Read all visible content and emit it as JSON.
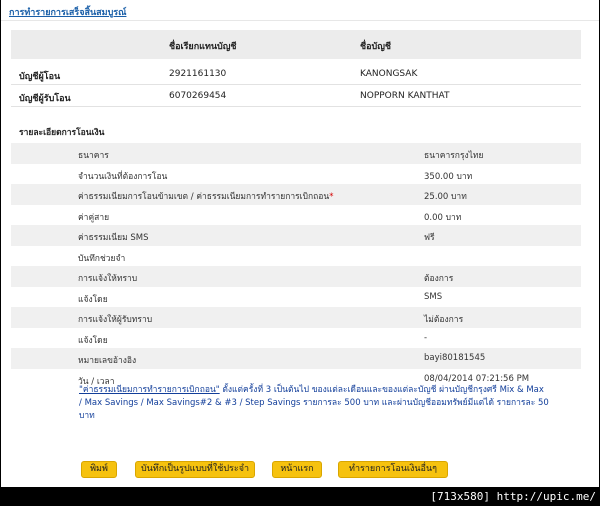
{
  "title": "การทำรายการเสร็จสิ้นสมบูรณ์",
  "accounts": {
    "header": {
      "col_nick": "ชื่อเรียกแทนบัญชี",
      "col_name": "ชื่อบัญชี"
    },
    "rows": [
      {
        "label": "บัญชีผู้โอน",
        "number": "2921161130",
        "name": "KANONGSAK"
      },
      {
        "label": "บัญชีผู้รับโอน",
        "number": "6070269454",
        "name": "NOPPORN KANTHAT"
      }
    ]
  },
  "details": {
    "title": "รายละเอียดการโอนเงิน",
    "rows": [
      {
        "label": "ธนาคาร",
        "value": "ธนาคารกรุงไทย"
      },
      {
        "label": "จำนวนเงินที่ต้องการโอน",
        "value": "350.00 บาท"
      },
      {
        "label": "ค่าธรรมเนียมการโอนข้ามเขต / ค่าธรรมเนียมการทำรายการเบิกถอน",
        "required": "*",
        "value": "25.00 บาท"
      },
      {
        "label": "ค่าคู่สาย",
        "value": "0.00 บาท"
      },
      {
        "label": "ค่าธรรมเนียม SMS",
        "value": "ฟรี"
      },
      {
        "label": "บันทึกช่วยจำ",
        "value": ""
      },
      {
        "label": "การแจ้งให้ทราบ",
        "value": "ต้องการ"
      },
      {
        "label": "แจ้งโดย",
        "value": "SMS"
      },
      {
        "label": "การแจ้งให้ผู้รับทราบ",
        "value": "ไม่ต้องการ"
      },
      {
        "label": "แจ้งโดย",
        "value": "-"
      },
      {
        "label": "หมายเลขอ้างอิง",
        "value": "bayi80181545"
      },
      {
        "label": "วัน / เวลา",
        "value": "08/04/2014 07:21:56 PM"
      }
    ]
  },
  "note": {
    "fee_term": "\"ค่าธรรมเนียมการทำรายการเบิกถอน\"",
    "text": " ตั้งแต่ครั้งที่ 3 เป็นต้นไป ของแต่ละเดือนและของแต่ละบัญชี ผ่านบัญชีกรุงศรี Mix & Max / Max Savings / Max Savings#2 & #3 / Step Savings รายการละ 500 บาท และผ่านบัญชีออมทรัพย์มีแต่ได้ รายการละ 50 บาท"
  },
  "buttons": {
    "print": "พิมพ์",
    "save_template": "บันทึกเป็นรูปแบบที่ใช้ประจำ",
    "home": "หน้าแรก",
    "new_transfer": "ทำรายการโอนเงินอื่นๆ"
  },
  "watermark": "[713x580] http://upic.me/"
}
